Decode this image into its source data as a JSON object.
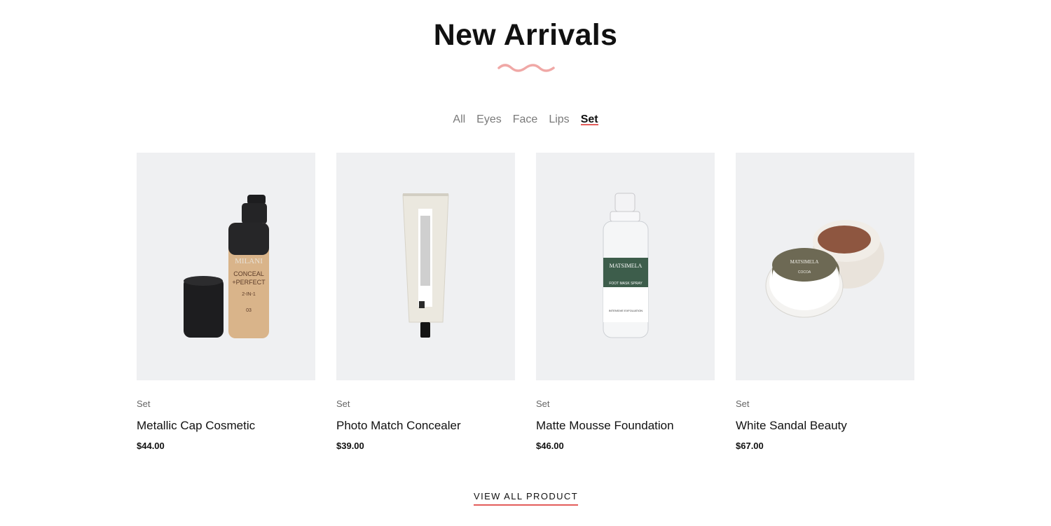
{
  "section": {
    "title": "New Arrivals",
    "accent_color": "#e35d5b",
    "wave_color": "#f0a8a6"
  },
  "tabs": [
    {
      "label": "All",
      "active": false
    },
    {
      "label": "Eyes",
      "active": false
    },
    {
      "label": "Face",
      "active": false
    },
    {
      "label": "Lips",
      "active": false
    },
    {
      "label": "Set",
      "active": true
    }
  ],
  "products": [
    {
      "category": "Set",
      "name": "Metallic Cap Cosmetic",
      "price": "$44.00",
      "image": "foundation-bottle-image",
      "label_lines": [
        "MILANI",
        "CONCEAL",
        "+PERFECT",
        "2-IN-1",
        "03"
      ]
    },
    {
      "category": "Set",
      "name": "Photo Match Concealer",
      "price": "$39.00",
      "image": "cream-tube-image",
      "label_lines": []
    },
    {
      "category": "Set",
      "name": "Matte Mousse Foundation",
      "price": "$46.00",
      "image": "spray-bottle-image",
      "label_lines": [
        "MATSIMELA",
        "FOOT MASK SPRAY",
        "INTENSIVE EXFOLIATION"
      ]
    },
    {
      "category": "Set",
      "name": "White Sandal Beauty",
      "price": "$67.00",
      "image": "scrub-jar-image",
      "label_lines": [
        "MATSIMELA",
        "COCOA"
      ]
    }
  ],
  "view_all": {
    "label": "VIEW ALL PRODUCT"
  }
}
